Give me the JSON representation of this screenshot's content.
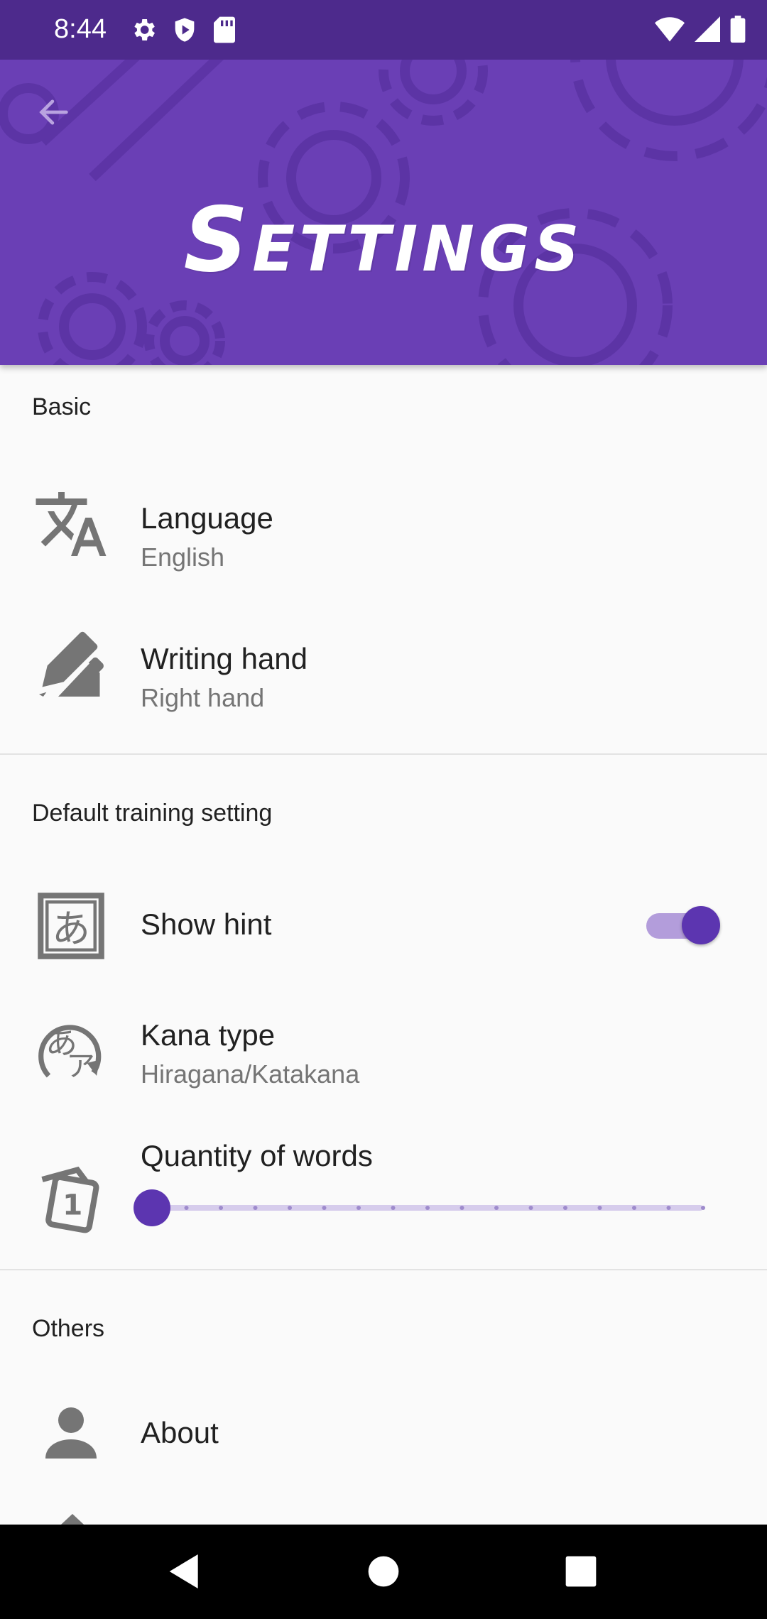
{
  "status_bar": {
    "time": "8:44",
    "left_icons": [
      "gear-icon",
      "shield-icon",
      "sd-card-icon"
    ],
    "right_icons": [
      "wifi-icon",
      "signal-icon",
      "battery-icon"
    ]
  },
  "header": {
    "title": "Settings",
    "back_icon": "arrow-left-icon",
    "background_color": "#6a3fb5"
  },
  "sections": {
    "basic": {
      "title": "Basic",
      "language": {
        "title": "Language",
        "value": "English",
        "icon": "translate-icon"
      },
      "writing_hand": {
        "title": "Writing hand",
        "value": "Right hand",
        "icon": "signature-icon"
      }
    },
    "training": {
      "title": "Default training setting",
      "show_hint": {
        "title": "Show hint",
        "enabled": true,
        "icon": "hiragana-box-icon"
      },
      "kana_type": {
        "title": "Kana type",
        "value": "Hiragana/Katakana",
        "icon": "kana-icon"
      },
      "quantity": {
        "title": "Quantity of words",
        "slider_fraction": 0,
        "icon": "cards-number-icon"
      }
    },
    "others": {
      "title": "Others",
      "about": {
        "title": "About",
        "icon": "person-icon"
      }
    }
  },
  "nav_bar": {
    "back_icon": "triangle-back-icon",
    "home_icon": "circle-home-icon",
    "recents_icon": "square-recents-icon"
  },
  "colors": {
    "accent": "#5c35b0",
    "accent_light": "#b39ddb",
    "status_bar": "#4d2a8c"
  }
}
